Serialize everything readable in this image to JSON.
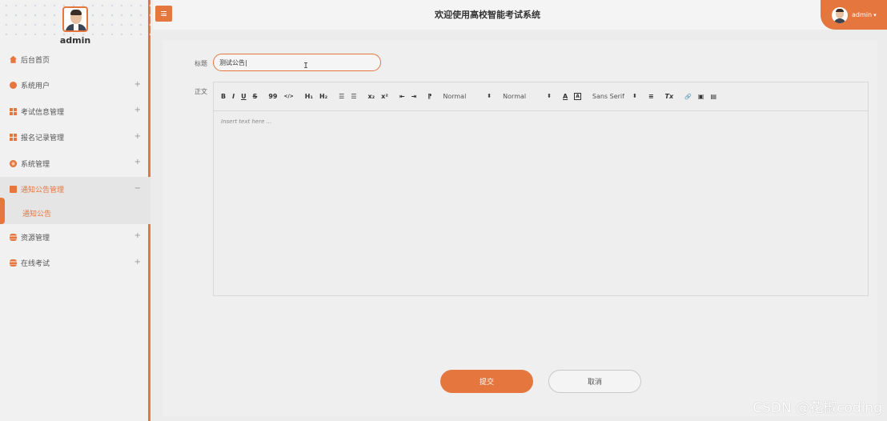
{
  "sidebar": {
    "username": "admin",
    "items": [
      {
        "label": "后台首页",
        "icon": "home-icon",
        "expandable": false
      },
      {
        "label": "系统用户",
        "icon": "user-icon",
        "expandable": true,
        "toggle": "+"
      },
      {
        "label": "考试信息管理",
        "icon": "grid-icon",
        "expandable": true,
        "toggle": "+"
      },
      {
        "label": "报名记录管理",
        "icon": "grid-icon",
        "expandable": true,
        "toggle": "+"
      },
      {
        "label": "系统管理",
        "icon": "gear-icon",
        "expandable": true,
        "toggle": "+"
      },
      {
        "label": "通知公告管理",
        "icon": "document-icon",
        "expandable": true,
        "toggle": "−",
        "active": true,
        "children": [
          {
            "label": "通知公告",
            "active": true
          }
        ]
      },
      {
        "label": "资源管理",
        "icon": "database-icon",
        "expandable": true,
        "toggle": "+"
      },
      {
        "label": "在线考试",
        "icon": "database-icon",
        "expandable": true,
        "toggle": "+"
      }
    ]
  },
  "header": {
    "title": "欢迎使用高校智能考试系统",
    "user": "admin",
    "user_caret": "▾"
  },
  "form": {
    "title_label": "标题",
    "title_value": "测试公告",
    "body_label": "正文",
    "editor_placeholder": "Insert text here ...",
    "toolbar": {
      "bold": "B",
      "italic": "I",
      "underline": "U",
      "strike": "S",
      "quote": "99",
      "code": "</>",
      "h1": "H₁",
      "h2": "H₂",
      "ordered_list": "☰",
      "bullet_list": "☰",
      "subscript": "x₂",
      "superscript": "x²",
      "outdent": "⇤",
      "indent": "⇥",
      "direction": "⁋",
      "size_select": "Normal",
      "header_select": "Normal",
      "color": "A",
      "background": "A",
      "font_select": "Sans Serif",
      "align": "≡",
      "clean": "Tx",
      "link": "🔗",
      "image": "▣",
      "video": "▤"
    },
    "submit_label": "提交",
    "cancel_label": "取消"
  },
  "watermark": "CSDN @花椒coding",
  "colors": {
    "accent": "#e5763e",
    "sidebar_bg": "#f1f1f1",
    "content_bg": "#efefef"
  }
}
